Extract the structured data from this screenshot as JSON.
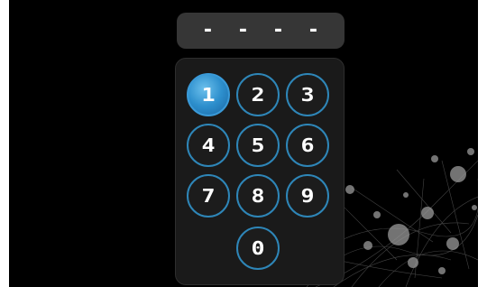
{
  "pin": {
    "slots": [
      "-",
      "-",
      "-",
      "-"
    ]
  },
  "keypad": {
    "keys": [
      "1",
      "2",
      "3",
      "4",
      "5",
      "6",
      "7",
      "8",
      "9",
      "0"
    ],
    "active_key": "1",
    "accent_color": "#2e86b8"
  }
}
